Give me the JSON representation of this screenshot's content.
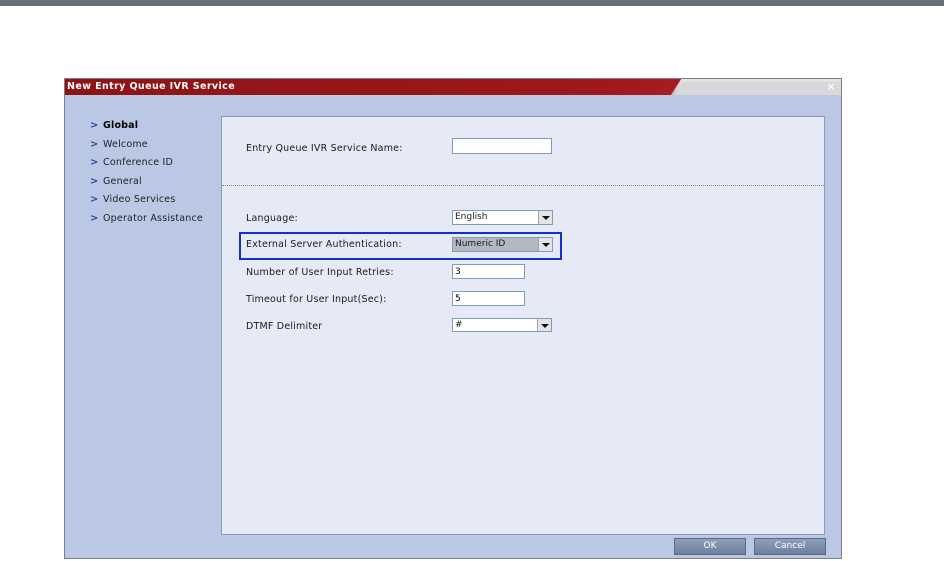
{
  "dialog": {
    "title": "New Entry Queue IVR Service",
    "close_glyph": "×"
  },
  "sidebar": {
    "items": [
      {
        "label": "Global",
        "active": true
      },
      {
        "label": "Welcome",
        "active": false
      },
      {
        "label": "Conference ID",
        "active": false
      },
      {
        "label": "General",
        "active": false
      },
      {
        "label": "Video Services",
        "active": false
      },
      {
        "label": "Operator Assistance",
        "active": false
      }
    ],
    "arrow_glyph": ">"
  },
  "form": {
    "service_name": {
      "label": "Entry Queue IVR Service Name:",
      "value": ""
    },
    "language": {
      "label": "Language:",
      "value": "English"
    },
    "ext_auth": {
      "label": "External Server Authentication:",
      "value": "Numeric ID"
    },
    "retries": {
      "label": "Number of User Input Retries:",
      "value": "3"
    },
    "timeout": {
      "label": "Timeout for User Input(Sec):",
      "value": "5"
    },
    "dtmf": {
      "label": "DTMF Delimiter",
      "value": "#"
    }
  },
  "buttons": {
    "ok": "OK",
    "cancel": "Cancel"
  },
  "colors": {
    "titlebar": "#9a1719",
    "dialog_bg": "#bac8e6",
    "panel_bg": "#e6eaf6",
    "highlight_border": "#1530c8",
    "button": "#7c8eab"
  },
  "icons": {
    "close": "close-icon",
    "nav_arrow": "chevron-right-icon",
    "dropdown": "chevron-down-icon"
  }
}
